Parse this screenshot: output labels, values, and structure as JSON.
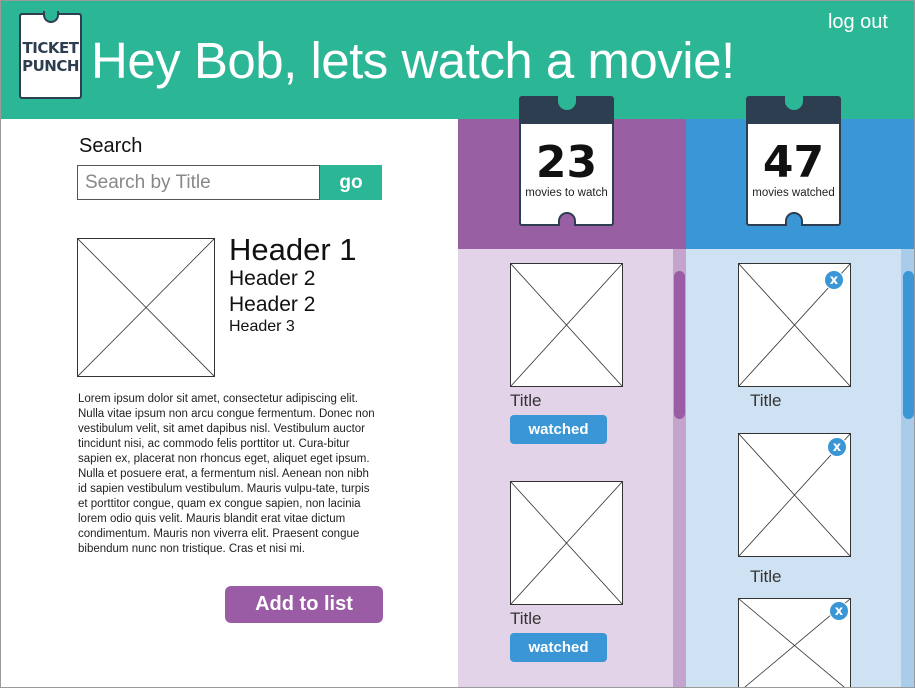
{
  "header": {
    "logo_text": "TICKET PUNCH",
    "logo_line1": "TICKET",
    "logo_line2": "PUNCH",
    "title": "Hey Bob, lets watch a movie!",
    "logout_label": "log out"
  },
  "search": {
    "label": "Search",
    "placeholder": "Search by Title",
    "value": "",
    "go_label": "go"
  },
  "detail": {
    "header1": "Header 1",
    "header2a": "Header 2",
    "header2b": "Header 2",
    "header3": "Header 3",
    "body": "Lorem ipsum dolor sit amet, consectetur adipiscing elit. Nulla vitae ipsum non arcu congue fermentum. Donec non vestibulum velit, sit amet dapibus nisl. Vestibulum auctor tincidunt nisi, ac commodo felis porttitor ut. Cura-bitur sapien ex, placerat non rhoncus eget, aliquet eget ipsum. Nulla et posuere erat, a fermentum nisl. Aenean non nibh id sapien vestibulum vestibulum. Mauris vulpu-tate, turpis et porttitor congue, quam ex congue sapien, non lacinia lorem odio quis velit. Mauris blandit erat vitae dictum condimentum. Mauris non viverra elit. Praesent congue bibendum nunc non tristique. Cras et nisi mi.",
    "add_label": "Add to list"
  },
  "to_watch": {
    "count": "23",
    "label": "movies to watch",
    "items": [
      {
        "title": "Title",
        "button": "watched"
      },
      {
        "title": "Title",
        "button": "watched"
      }
    ]
  },
  "watched": {
    "count": "47",
    "label": "movies watched",
    "items": [
      {
        "title": "Title",
        "remove": "x"
      },
      {
        "title": "Title",
        "remove": "x"
      },
      {
        "remove": "x"
      }
    ]
  },
  "colors": {
    "teal": "#2bb696",
    "purple": "#995fa3",
    "purple_light": "#e3d3e8",
    "blue": "#3b96d6",
    "blue_light": "#cfe2f3",
    "navy": "#2d3e50"
  }
}
